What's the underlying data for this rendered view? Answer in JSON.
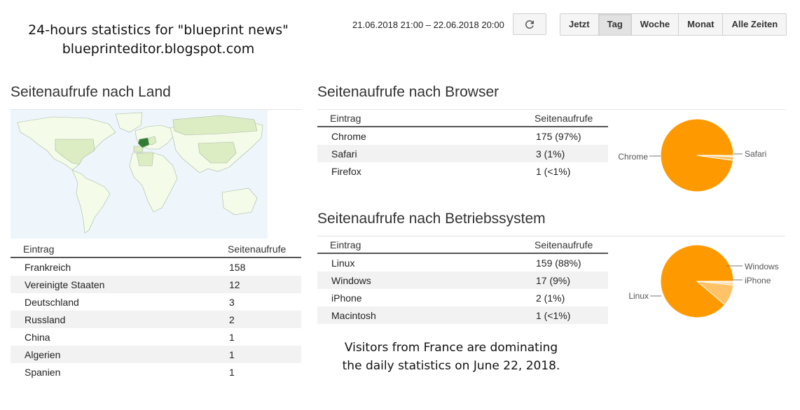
{
  "caption": {
    "line1": "24-hours statistics for \"blueprint news\"",
    "line2": "blueprinteditor.blogspot.com"
  },
  "toolbar": {
    "date_range": "21.06.2018 21:00 – 22.06.2018 20:00",
    "refresh_icon": "refresh-icon",
    "buttons": [
      "Jetzt",
      "Tag",
      "Woche",
      "Monat",
      "Alle Zeiten"
    ],
    "active": "Tag"
  },
  "country": {
    "title": "Seitenaufrufe nach Land",
    "header": {
      "entry": "Eintrag",
      "views": "Seitenaufrufe"
    },
    "rows": [
      {
        "entry": "Frankreich",
        "views": "158"
      },
      {
        "entry": "Vereinigte Staaten",
        "views": "12"
      },
      {
        "entry": "Deutschland",
        "views": "3"
      },
      {
        "entry": "Russland",
        "views": "2"
      },
      {
        "entry": "China",
        "views": "1"
      },
      {
        "entry": "Algerien",
        "views": "1"
      },
      {
        "entry": "Spanien",
        "views": "1"
      }
    ],
    "map_colors": {
      "ocean": "#eef6fc",
      "land": "#f4fbe9",
      "light": "#dcedc4",
      "top": "#2e7d32"
    }
  },
  "browser": {
    "title": "Seitenaufrufe nach Browser",
    "header": {
      "entry": "Eintrag",
      "views": "Seitenaufrufe"
    },
    "rows": [
      {
        "entry": "Chrome",
        "views": "175 (97%)"
      },
      {
        "entry": "Safari",
        "views": "3 (1%)"
      },
      {
        "entry": "Firefox",
        "views": "1 (<1%)"
      }
    ],
    "pie": {
      "slices": [
        {
          "label": "Chrome",
          "value": 175,
          "color": "#ff9900"
        },
        {
          "label": "Safari",
          "value": 3,
          "color": "#ffc266"
        },
        {
          "label": "Firefox",
          "value": 1,
          "color": "#ffd699"
        }
      ]
    }
  },
  "os": {
    "title": "Seitenaufrufe nach Betriebssystem",
    "header": {
      "entry": "Eintrag",
      "views": "Seitenaufrufe"
    },
    "rows": [
      {
        "entry": "Linux",
        "views": "159 (88%)"
      },
      {
        "entry": "Windows",
        "views": "17 (9%)"
      },
      {
        "entry": "iPhone",
        "views": "2 (1%)"
      },
      {
        "entry": "Macintosh",
        "views": "1 (<1%)"
      }
    ],
    "pie": {
      "slices": [
        {
          "label": "Linux",
          "value": 159,
          "color": "#ff9900"
        },
        {
          "label": "Windows",
          "value": 17,
          "color": "#ffc266"
        },
        {
          "label": "iPhone",
          "value": 2,
          "color": "#ffd699"
        },
        {
          "label": "Macintosh",
          "value": 1,
          "color": "#ffe4b3"
        }
      ]
    }
  },
  "note": {
    "line1": "Visitors from France are dominating",
    "line2": "the daily statistics on June 22, 2018."
  }
}
